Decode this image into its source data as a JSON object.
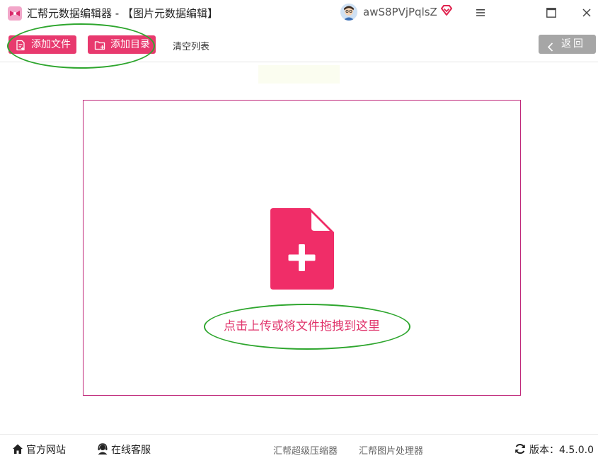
{
  "window": {
    "title": "汇帮元数据编辑器 - 【图片元数据编辑】",
    "username": "awS8PVjPqlsZ"
  },
  "toolbar": {
    "add_file_label": "添加文件",
    "add_dir_label": "添加目录",
    "clear_list_label": "清空列表",
    "back_label": "返回"
  },
  "dropzone": {
    "hint": "点击上传或将文件拖拽到这里"
  },
  "footer": {
    "website_label": "官方网站",
    "service_label": "在线客服",
    "compressor_label": "汇帮超级压缩器",
    "image_processor_label": "汇帮图片处理器",
    "version_label": "版本：4.5.0.0"
  },
  "colors": {
    "accent": "#e8396e",
    "dropzone_border": "#c0287a",
    "back_button": "#a6a6a6",
    "annotation": "#2ea62e"
  },
  "icons": {
    "logo": "app-logo-icon",
    "vip": "vip-diamond-icon",
    "menu": "hamburger-menu-icon",
    "maximize": "maximize-icon",
    "close": "close-icon",
    "add_file": "file-add-icon",
    "add_dir": "folder-add-icon",
    "back": "chevron-left-icon",
    "home": "home-icon",
    "service": "headset-icon",
    "refresh": "refresh-icon"
  }
}
